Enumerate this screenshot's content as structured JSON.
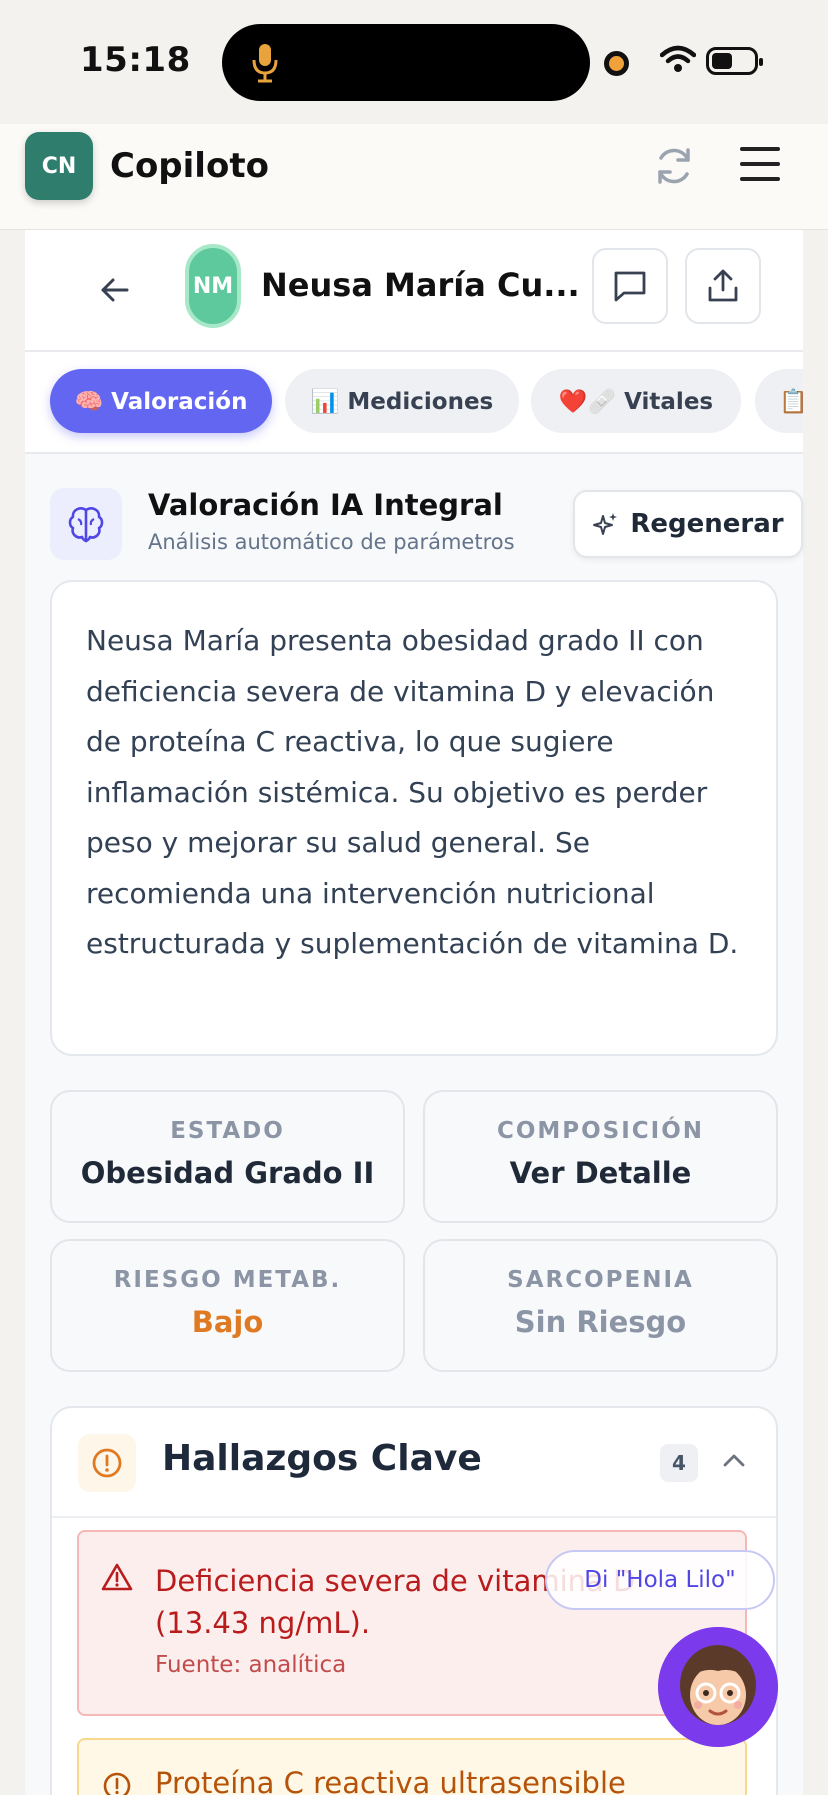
{
  "status": {
    "time": "15:18"
  },
  "app": {
    "logo": "CN",
    "title": "Copiloto"
  },
  "patient": {
    "initials": "NM",
    "name": "Neusa María Cu..."
  },
  "tabs": [
    {
      "label": "🧠 Valoración",
      "active": true
    },
    {
      "label": "📊 Mediciones",
      "active": false
    },
    {
      "label": "❤️🩹 Vitales",
      "active": false
    },
    {
      "label": "📋",
      "active": false
    }
  ],
  "section": {
    "title": "Valoración IA Integral",
    "subtitle": "Análisis automático de parámetros",
    "regen_label": "Regenerar"
  },
  "summary": "Neusa María presenta obesidad grado II con deficiencia severa de vitamina D y elevación de proteína C reactiva, lo que sugiere inflamación sistémica. Su objetivo es perder peso y mejorar su salud general. Se recomienda una intervención nutricional estructurada y suplementación de vitamina D.",
  "stats": [
    {
      "label": "ESTADO",
      "value": "Obesidad Grado II",
      "color": "#1f2937"
    },
    {
      "label": "COMPOSICIÓN",
      "value": "Ver Detalle",
      "color": "#1f2937"
    },
    {
      "label": "RIESGO METAB.",
      "value": "Bajo",
      "color": "#e07a22"
    },
    {
      "label": "SARCOPENIA",
      "value": "Sin Riesgo",
      "color": "#8b95a5"
    }
  ],
  "findings": {
    "title": "Hallazgos Clave",
    "count": "4",
    "items": [
      {
        "title": "Deficiencia severa de vitamina D (13.43 ng/mL).",
        "source": "Fuente: analítica",
        "severity": "high"
      },
      {
        "title": "Proteína C reactiva ultrasensible",
        "severity": "medium"
      }
    ]
  },
  "assistant": {
    "prompt": "Di \"Hola Lilo\""
  },
  "colors": {
    "accent": "#6366f1",
    "brand": "#2f7d6d",
    "danger": "#b91c1c",
    "warning": "#b45309"
  }
}
